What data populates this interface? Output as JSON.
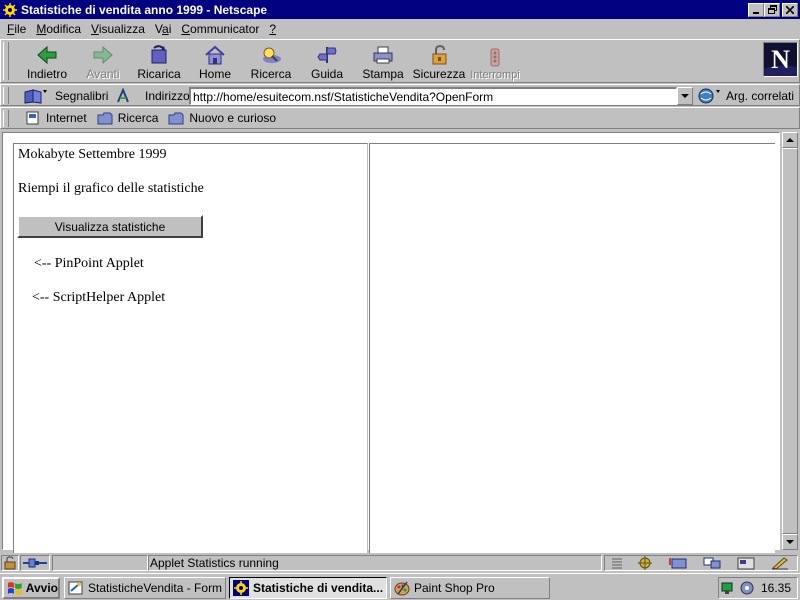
{
  "window": {
    "title": "Statistiche di vendita anno 1999 - Netscape"
  },
  "menu": [
    "File",
    "Modifica",
    "Visualizza",
    "Vai",
    "Communicator",
    "?"
  ],
  "menu_underline": [
    "F",
    "M",
    "V",
    "a",
    "C",
    "?"
  ],
  "nav_toolbar": {
    "buttons": [
      {
        "label": "Indietro",
        "icon": "back-arrow-icon",
        "enabled": true
      },
      {
        "label": "Avanti",
        "icon": "forward-arrow-icon",
        "enabled": false
      },
      {
        "label": "Ricarica",
        "icon": "reload-icon",
        "enabled": true
      },
      {
        "label": "Home",
        "icon": "home-icon",
        "enabled": true
      },
      {
        "label": "Ricerca",
        "icon": "search-icon",
        "enabled": true
      },
      {
        "label": "Guida",
        "icon": "guide-icon",
        "enabled": true
      },
      {
        "label": "Stampa",
        "icon": "print-icon",
        "enabled": true
      },
      {
        "label": "Sicurezza",
        "icon": "security-lock-icon",
        "enabled": true
      },
      {
        "label": "Interrompi",
        "icon": "stop-icon",
        "enabled": false
      }
    ]
  },
  "location_bar": {
    "bookmarks_label": "Segnalibri",
    "address_label": "Indirizzo:",
    "url": "http://home/esuitecom.nsf/StatisticheVendita?OpenForm",
    "related_label": "Arg. correlati"
  },
  "personal_toolbar": {
    "items": [
      "Internet",
      "Ricerca",
      "Nuovo e curioso"
    ]
  },
  "page": {
    "heading": "Mokabyte Settembre 1999",
    "instruction": "Riempi il grafico delle statistiche",
    "show_button": "Visualizza statistiche",
    "pinpoint_note": "<-- PinPoint Applet",
    "scripthelper_note": "<-- ScriptHelper Applet"
  },
  "status": {
    "text": "Applet Statistics running"
  },
  "taskbar": {
    "start_label": "Avvio",
    "tasks": [
      {
        "label": "StatisticheVendita - Form - ...",
        "active": false
      },
      {
        "label": "Statistiche di vendita...",
        "active": true
      },
      {
        "label": "Paint Shop Pro",
        "active": false
      }
    ],
    "clock": "16.35"
  },
  "colors": {
    "titlebar": "#000080",
    "face": "#c0c0c0"
  }
}
